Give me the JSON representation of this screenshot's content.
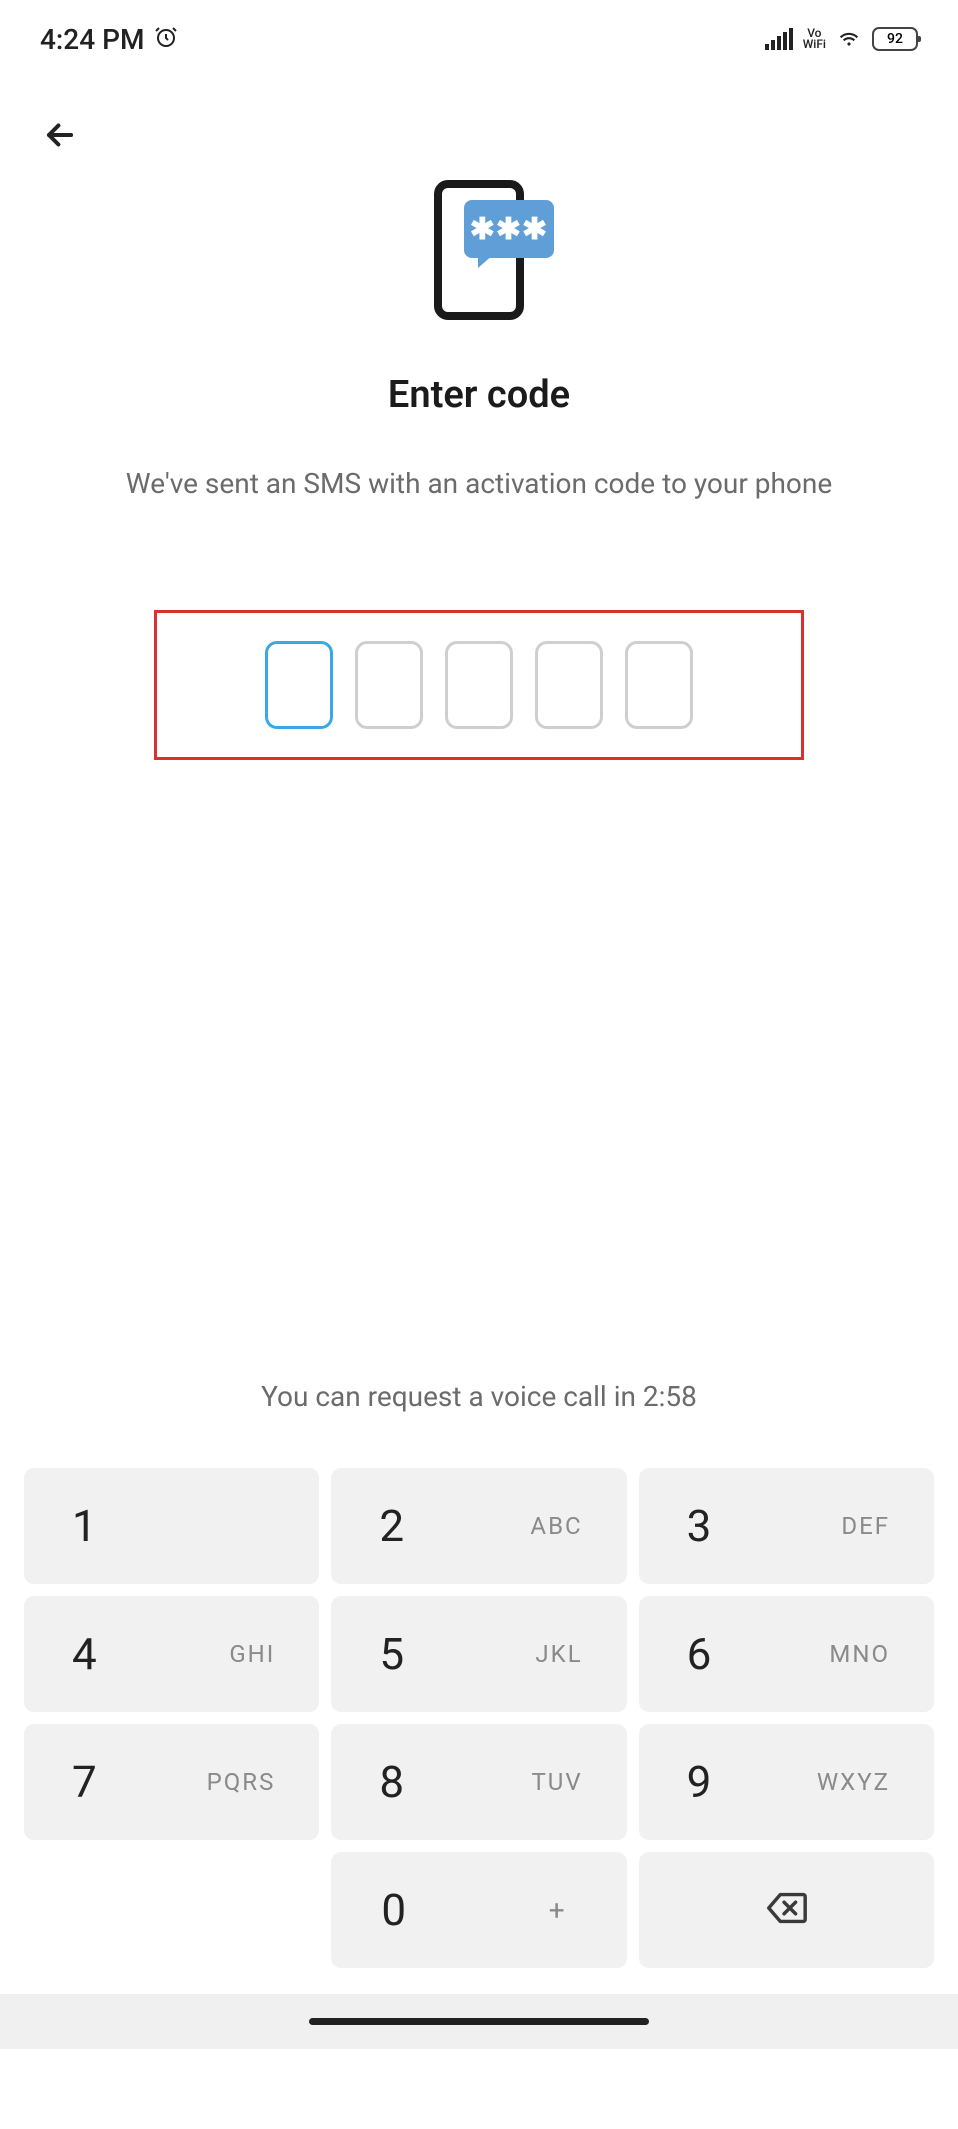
{
  "status": {
    "time": "4:24 PM",
    "vowifi_top": "Vo",
    "vowifi_bottom": "WiFi",
    "battery": "92"
  },
  "header": {
    "title": "Enter code",
    "subtitle": "We've sent an SMS with an activation code to your phone"
  },
  "otp": {
    "digits": [
      "",
      "",
      "",
      "",
      ""
    ]
  },
  "hint": {
    "voice_call": "You can request a voice call in 2:58"
  },
  "keypad": {
    "k1": {
      "num": "1",
      "letters": ""
    },
    "k2": {
      "num": "2",
      "letters": "ABC"
    },
    "k3": {
      "num": "3",
      "letters": "DEF"
    },
    "k4": {
      "num": "4",
      "letters": "GHI"
    },
    "k5": {
      "num": "5",
      "letters": "JKL"
    },
    "k6": {
      "num": "6",
      "letters": "MNO"
    },
    "k7": {
      "num": "7",
      "letters": "PQRS"
    },
    "k8": {
      "num": "8",
      "letters": "TUV"
    },
    "k9": {
      "num": "9",
      "letters": "WXYZ"
    },
    "k0": {
      "num": "0",
      "letters": "+"
    }
  }
}
